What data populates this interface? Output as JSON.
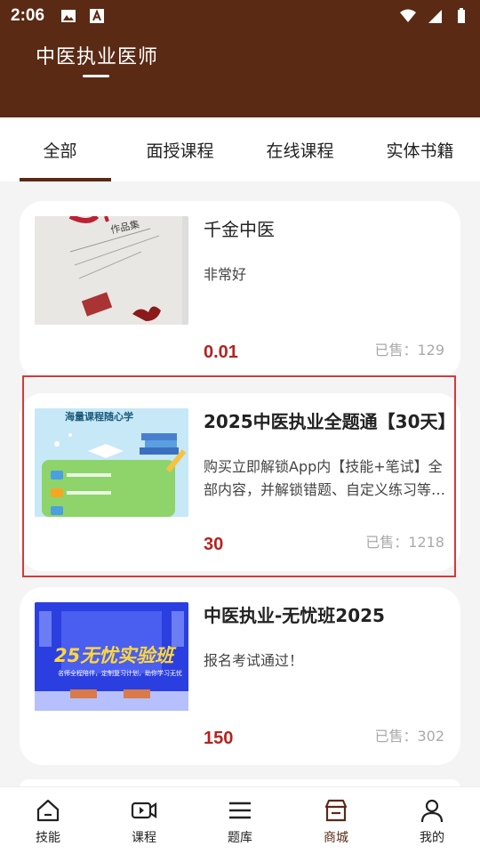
{
  "status": {
    "time": "2:06"
  },
  "header": {
    "title": "中医执业医师"
  },
  "tabs": [
    {
      "label": "全部",
      "active": true
    },
    {
      "label": "面授课程",
      "active": false
    },
    {
      "label": "在线课程",
      "active": false
    },
    {
      "label": "实体书籍",
      "active": false
    }
  ],
  "products": [
    {
      "title": "千金中医",
      "desc": "非常好",
      "price": "0.01",
      "sold": "已售：129",
      "thumb_text": "作品集"
    },
    {
      "title": "2025中医执业全题通【30天】",
      "desc": "购买立即解锁App内【技能+笔试】全部内容，并解锁错题、自定义练习等功能",
      "price": "30",
      "sold": "已售：1218",
      "thumb_text": "海量课程随心学"
    },
    {
      "title": "中医执业-无忧班2025",
      "desc": "报名考试通过！",
      "price": "150",
      "sold": "已售：302",
      "thumb_text": "25无忧实验班",
      "thumb_sub": "名师全程陪伴，定制复习计划，助你学习无忧"
    }
  ],
  "nav": [
    {
      "label": "技能",
      "icon": "home-icon"
    },
    {
      "label": "课程",
      "icon": "video-icon"
    },
    {
      "label": "题库",
      "icon": "menu-icon"
    },
    {
      "label": "商城",
      "icon": "store-icon",
      "active": true
    },
    {
      "label": "我的",
      "icon": "user-icon"
    }
  ],
  "colors": {
    "brand": "#5a2a14",
    "price": "#b5231f",
    "highlight": "#d33a3a"
  }
}
